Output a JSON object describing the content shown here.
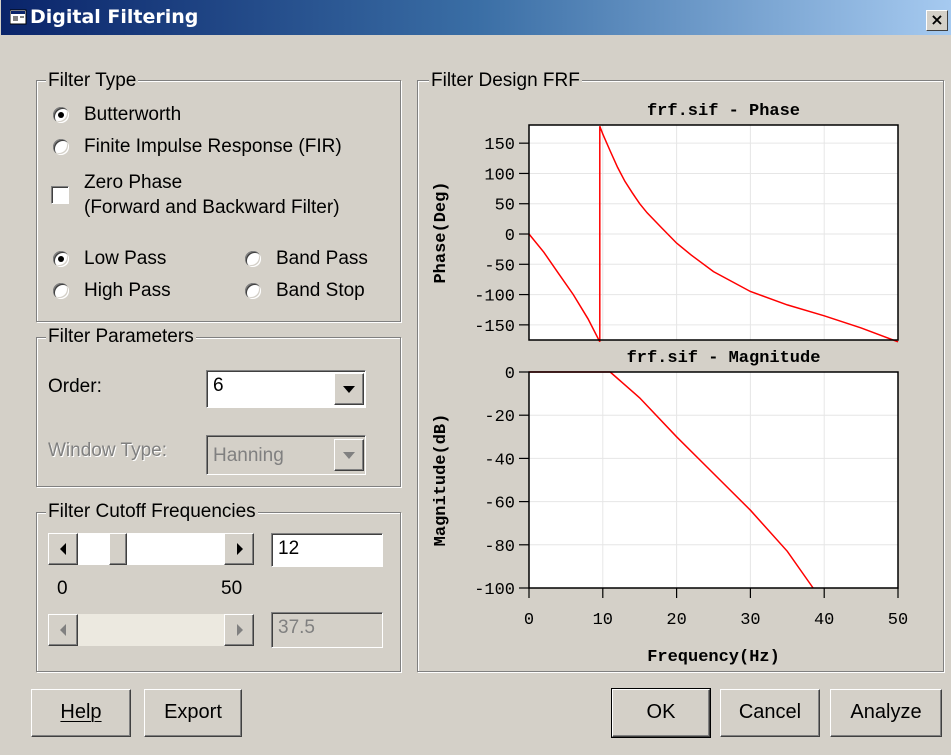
{
  "window": {
    "title": "Digital Filtering",
    "close_label": "×"
  },
  "filter_type": {
    "legend": "Filter Type",
    "design_options": [
      {
        "label": "Butterworth",
        "selected": true
      },
      {
        "label": "Finite Impulse Response (FIR)",
        "selected": false
      }
    ],
    "zero_phase": {
      "label_line1": "Zero Phase",
      "label_line2": "(Forward and Backward Filter)",
      "checked": false
    },
    "pass_options": [
      {
        "label": "Low Pass",
        "selected": true
      },
      {
        "label": "High Pass",
        "selected": false
      },
      {
        "label": "Band Pass",
        "selected": false
      },
      {
        "label": "Band Stop",
        "selected": false
      }
    ]
  },
  "filter_parameters": {
    "legend": "Filter Parameters",
    "order_label": "Order:",
    "order_value": "6",
    "window_type_label": "Window Type:",
    "window_type_value": "Hanning",
    "window_type_enabled": false
  },
  "cutoff": {
    "legend": "Filter Cutoff Frequencies",
    "slider1": {
      "value": "12",
      "position_fraction": 0.24
    },
    "range_min": "0",
    "range_max": "50",
    "slider2": {
      "value": "37.5",
      "enabled": false
    }
  },
  "frf_panel": {
    "legend": "Filter Design FRF"
  },
  "chart_data": [
    {
      "type": "line",
      "title": "frf.sif - Phase",
      "ylabel": "Phase(Deg)",
      "xlabel": "",
      "xlim": [
        0,
        50
      ],
      "ylim": [
        -175,
        180
      ],
      "yticks": [
        150,
        100,
        50,
        0,
        -50,
        -100,
        -150
      ],
      "ytick_labels": [
        "150",
        "100",
        "50",
        "0",
        "-50",
        "-100",
        "-150"
      ],
      "grid": true,
      "color": "#ff0000",
      "x": [
        0,
        2,
        4,
        6,
        8,
        9.6,
        9.6,
        10,
        11,
        12,
        13,
        14,
        15,
        16,
        18,
        20,
        22,
        25,
        30,
        35,
        40,
        45,
        50
      ],
      "y": [
        0,
        -30,
        -65,
        -100,
        -140,
        -178,
        178,
        165,
        137,
        110,
        87,
        68,
        50,
        35,
        10,
        -15,
        -35,
        -62,
        -95,
        -117,
        -135,
        -155,
        -178
      ]
    },
    {
      "type": "line",
      "title": "frf.sif - Magnitude",
      "ylabel": "Magnitude(dB)",
      "xlabel": "Frequency(Hz)",
      "xlim": [
        0,
        50
      ],
      "ylim": [
        -100,
        0
      ],
      "xticks": [
        0,
        10,
        20,
        30,
        40,
        50
      ],
      "xtick_labels": [
        "0",
        "10",
        "20",
        "30",
        "40",
        "50"
      ],
      "yticks": [
        0,
        -20,
        -40,
        -60,
        -80,
        -100
      ],
      "ytick_labels": [
        "0",
        "-20",
        "-40",
        "-60",
        "-80",
        "-100"
      ],
      "grid": true,
      "color": "#ff0000",
      "x": [
        0,
        8,
        10,
        11,
        12,
        15,
        20,
        25,
        30,
        35,
        38.5
      ],
      "y": [
        0,
        0,
        0,
        0,
        -3,
        -12,
        -30,
        -47,
        -64,
        -83,
        -100
      ]
    }
  ],
  "buttons": {
    "help": "Help",
    "export": "Export",
    "ok": "OK",
    "cancel": "Cancel",
    "analyze": "Analyze"
  }
}
